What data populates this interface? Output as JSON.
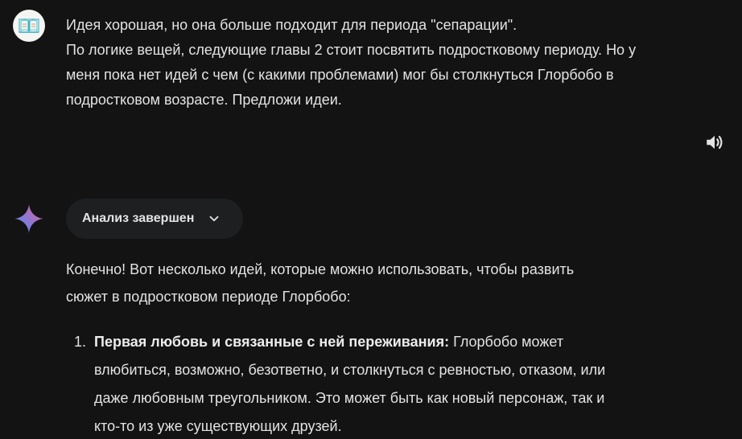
{
  "user_message": {
    "avatar_icon": "book-logo-icon",
    "lines": [
      "Идея хорошая, но она больше подходит для периода \"сепарации\".",
      "По логике вещей, следующие главы 2 стоит посвятить подростковому периоду. Но у",
      "меня пока нет идей с чем (с какими проблемами) мог бы столкнуться Глорбобо в",
      "подростковом возрасте. Предложи идеи."
    ]
  },
  "controls": {
    "speaker_icon": "speaker-icon"
  },
  "assistant": {
    "icon": "gemini-star-icon",
    "analysis_label": "Анализ завершен",
    "intro_lines": [
      "Конечно! Вот несколько идей, которые можно использовать, чтобы развить",
      "сюжет в подростковом периоде Глорбобо:"
    ],
    "items": [
      {
        "number": "1.",
        "title": "Первая любовь и связанные с ней переживания:",
        "text_first": " Глорбобо может",
        "lines": [
          "влюбиться, возможно, безответно, и столкнуться с ревностью, отказом, или",
          "даже любовным треугольником. Это может быть как новый персонаж, так и",
          "кто-то из уже существующих друзей."
        ]
      }
    ]
  },
  "colors": {
    "background": "#131314",
    "text": "#e3e3e3",
    "pill": "#1e1f20",
    "star_blue": "#4f8ff7",
    "star_red": "#e5727e"
  }
}
